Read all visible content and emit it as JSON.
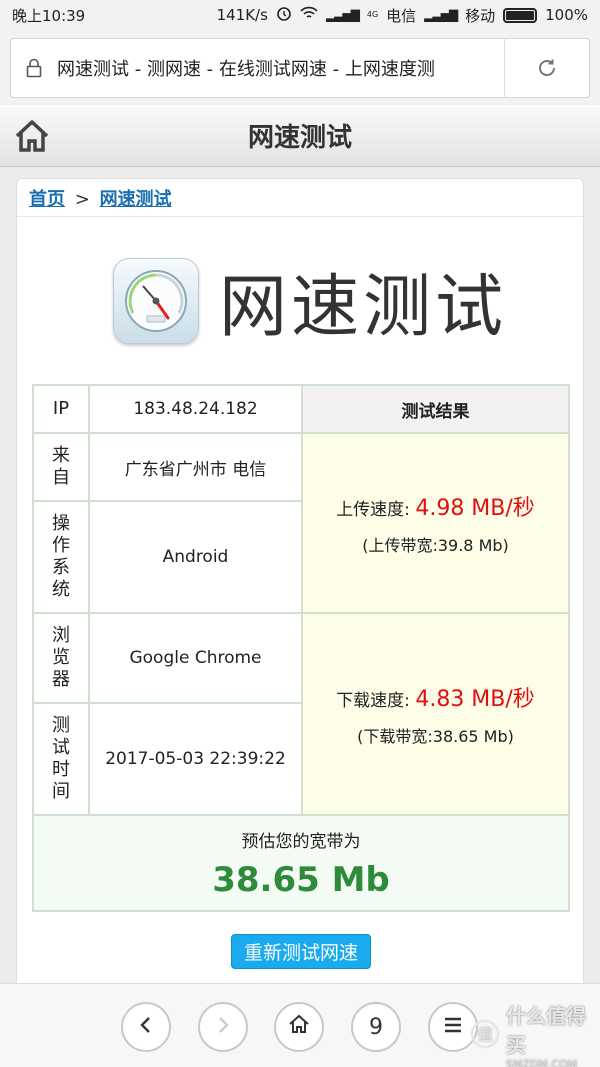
{
  "status_bar": {
    "time": "晚上10:39",
    "net_speed": "141K/s",
    "carrier_1": "电信",
    "carrier_2": "移动",
    "battery": "100%",
    "network_tag": "4G"
  },
  "address_bar": {
    "url_text": "网速测试 - 测网速 - 在线测试网速 - 上网速度测"
  },
  "site_header": {
    "title": "网速测试"
  },
  "breadcrumb": {
    "home": "首页",
    "separator": ">",
    "current": "网速测试"
  },
  "hero": {
    "title": "网速测试"
  },
  "table": {
    "ip_label": "IP",
    "ip_value": "183.48.24.182",
    "result_header": "测试结果",
    "from_label": "来自",
    "from_value": "广东省广州市 电信",
    "os_label": "操作系统",
    "os_value": "Android",
    "browser_label": "浏览器",
    "browser_value": "Google Chrome",
    "time_label": "测试时间",
    "time_value": "2017-05-03 22:39:22",
    "upload_label": "上传速度:",
    "upload_speed": "4.98 MB/秒",
    "upload_bw": "(上传带宽:39.8 Mb)",
    "download_label": "下载速度:",
    "download_speed": "4.83 MB/秒",
    "download_bw": "(下载带宽:38.65 Mb)",
    "estimate_label": "预估您的宽带为",
    "estimate_value": "38.65 Mb"
  },
  "retest_button": "重新测试网速",
  "bottom_bar": {
    "tab_count": "9"
  },
  "watermark": {
    "text": "什么值得买",
    "sub": "SMZDM.COM"
  },
  "colors": {
    "link": "#1a6fb0",
    "speed_red": "#e01010",
    "estimate_green": "#2e8b3a",
    "button_blue": "#19aaf0",
    "result_bg": "#fefde7"
  }
}
